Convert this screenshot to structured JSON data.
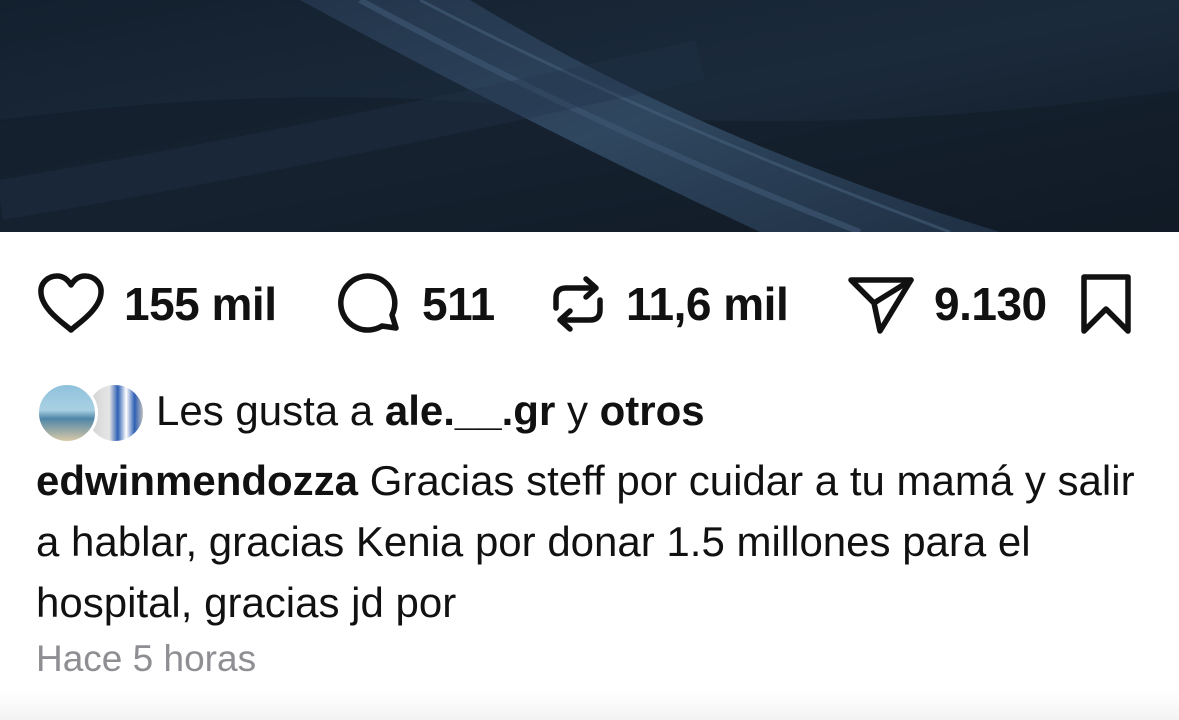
{
  "post": {
    "image_alt": "dark navy fabric close-up"
  },
  "actions": {
    "like_count": "155 mil",
    "comment_count": "511",
    "repost_count": "11,6 mil",
    "share_count": "9.130",
    "icons": {
      "like": "heart-icon",
      "comment": "comment-bubble-icon",
      "repost": "repost-arrows-icon",
      "share": "paper-plane-icon",
      "save": "bookmark-icon"
    }
  },
  "likes": {
    "prefix": "Les gusta a",
    "user": "ale.__.gr",
    "connector": "y",
    "others": "otros"
  },
  "caption": {
    "username": "edwinmendozza",
    "text": "Gracias steff por cuidar a tu mamá y salir a hablar, gracias Kenia por donar 1.5 millones para el hospital, gracias jd por"
  },
  "timestamp": "Hace 5 horas",
  "colors": {
    "image_bg": "#16212f",
    "text": "#111111",
    "muted": "#8e8e93"
  }
}
